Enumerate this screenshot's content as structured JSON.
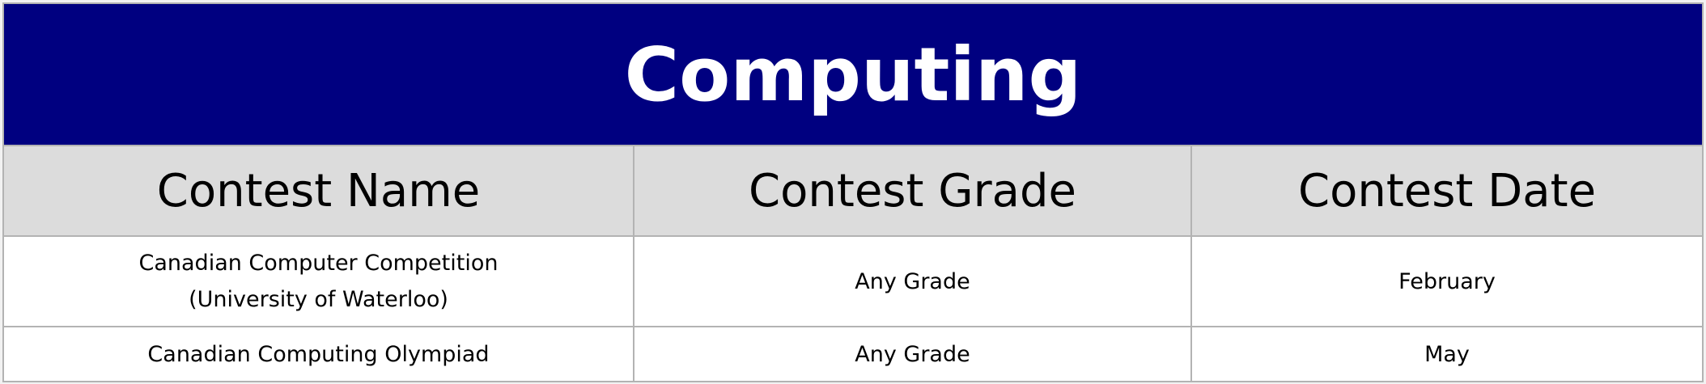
{
  "table": {
    "title": "Computing",
    "headers": [
      "Contest Name",
      "Contest Grade",
      "Contest Date"
    ],
    "rows": [
      {
        "name_line1": "Canadian Computer Competition",
        "name_line2": "(University of Waterloo)",
        "grade": "Any Grade",
        "date": "February"
      },
      {
        "name_line1": "Canadian Computing Olympiad",
        "grade": "Any Grade",
        "date": "May"
      }
    ]
  },
  "colors": {
    "title_background": "#000080",
    "header_background": "#dcdcdc",
    "border": "#b3b3b3"
  }
}
